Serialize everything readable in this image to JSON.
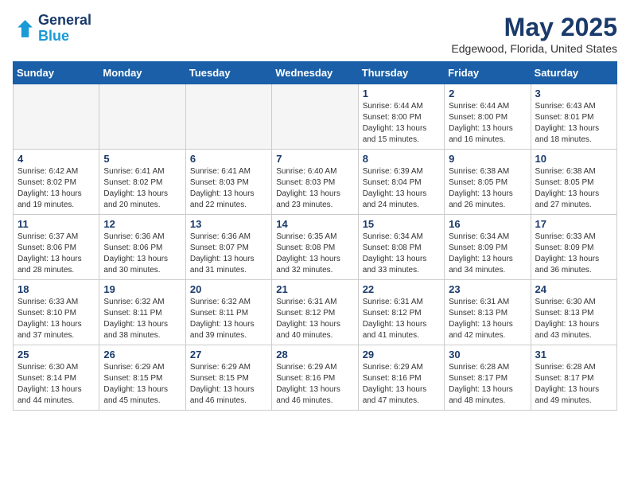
{
  "logo": {
    "line1": "General",
    "line2": "Blue"
  },
  "title": "May 2025",
  "subtitle": "Edgewood, Florida, United States",
  "days_of_week": [
    "Sunday",
    "Monday",
    "Tuesday",
    "Wednesday",
    "Thursday",
    "Friday",
    "Saturday"
  ],
  "weeks": [
    [
      {
        "num": "",
        "info": ""
      },
      {
        "num": "",
        "info": ""
      },
      {
        "num": "",
        "info": ""
      },
      {
        "num": "",
        "info": ""
      },
      {
        "num": "1",
        "info": "Sunrise: 6:44 AM\nSunset: 8:00 PM\nDaylight: 13 hours\nand 15 minutes."
      },
      {
        "num": "2",
        "info": "Sunrise: 6:44 AM\nSunset: 8:00 PM\nDaylight: 13 hours\nand 16 minutes."
      },
      {
        "num": "3",
        "info": "Sunrise: 6:43 AM\nSunset: 8:01 PM\nDaylight: 13 hours\nand 18 minutes."
      }
    ],
    [
      {
        "num": "4",
        "info": "Sunrise: 6:42 AM\nSunset: 8:02 PM\nDaylight: 13 hours\nand 19 minutes."
      },
      {
        "num": "5",
        "info": "Sunrise: 6:41 AM\nSunset: 8:02 PM\nDaylight: 13 hours\nand 20 minutes."
      },
      {
        "num": "6",
        "info": "Sunrise: 6:41 AM\nSunset: 8:03 PM\nDaylight: 13 hours\nand 22 minutes."
      },
      {
        "num": "7",
        "info": "Sunrise: 6:40 AM\nSunset: 8:03 PM\nDaylight: 13 hours\nand 23 minutes."
      },
      {
        "num": "8",
        "info": "Sunrise: 6:39 AM\nSunset: 8:04 PM\nDaylight: 13 hours\nand 24 minutes."
      },
      {
        "num": "9",
        "info": "Sunrise: 6:38 AM\nSunset: 8:05 PM\nDaylight: 13 hours\nand 26 minutes."
      },
      {
        "num": "10",
        "info": "Sunrise: 6:38 AM\nSunset: 8:05 PM\nDaylight: 13 hours\nand 27 minutes."
      }
    ],
    [
      {
        "num": "11",
        "info": "Sunrise: 6:37 AM\nSunset: 8:06 PM\nDaylight: 13 hours\nand 28 minutes."
      },
      {
        "num": "12",
        "info": "Sunrise: 6:36 AM\nSunset: 8:06 PM\nDaylight: 13 hours\nand 30 minutes."
      },
      {
        "num": "13",
        "info": "Sunrise: 6:36 AM\nSunset: 8:07 PM\nDaylight: 13 hours\nand 31 minutes."
      },
      {
        "num": "14",
        "info": "Sunrise: 6:35 AM\nSunset: 8:08 PM\nDaylight: 13 hours\nand 32 minutes."
      },
      {
        "num": "15",
        "info": "Sunrise: 6:34 AM\nSunset: 8:08 PM\nDaylight: 13 hours\nand 33 minutes."
      },
      {
        "num": "16",
        "info": "Sunrise: 6:34 AM\nSunset: 8:09 PM\nDaylight: 13 hours\nand 34 minutes."
      },
      {
        "num": "17",
        "info": "Sunrise: 6:33 AM\nSunset: 8:09 PM\nDaylight: 13 hours\nand 36 minutes."
      }
    ],
    [
      {
        "num": "18",
        "info": "Sunrise: 6:33 AM\nSunset: 8:10 PM\nDaylight: 13 hours\nand 37 minutes."
      },
      {
        "num": "19",
        "info": "Sunrise: 6:32 AM\nSunset: 8:11 PM\nDaylight: 13 hours\nand 38 minutes."
      },
      {
        "num": "20",
        "info": "Sunrise: 6:32 AM\nSunset: 8:11 PM\nDaylight: 13 hours\nand 39 minutes."
      },
      {
        "num": "21",
        "info": "Sunrise: 6:31 AM\nSunset: 8:12 PM\nDaylight: 13 hours\nand 40 minutes."
      },
      {
        "num": "22",
        "info": "Sunrise: 6:31 AM\nSunset: 8:12 PM\nDaylight: 13 hours\nand 41 minutes."
      },
      {
        "num": "23",
        "info": "Sunrise: 6:31 AM\nSunset: 8:13 PM\nDaylight: 13 hours\nand 42 minutes."
      },
      {
        "num": "24",
        "info": "Sunrise: 6:30 AM\nSunset: 8:13 PM\nDaylight: 13 hours\nand 43 minutes."
      }
    ],
    [
      {
        "num": "25",
        "info": "Sunrise: 6:30 AM\nSunset: 8:14 PM\nDaylight: 13 hours\nand 44 minutes."
      },
      {
        "num": "26",
        "info": "Sunrise: 6:29 AM\nSunset: 8:15 PM\nDaylight: 13 hours\nand 45 minutes."
      },
      {
        "num": "27",
        "info": "Sunrise: 6:29 AM\nSunset: 8:15 PM\nDaylight: 13 hours\nand 46 minutes."
      },
      {
        "num": "28",
        "info": "Sunrise: 6:29 AM\nSunset: 8:16 PM\nDaylight: 13 hours\nand 46 minutes."
      },
      {
        "num": "29",
        "info": "Sunrise: 6:29 AM\nSunset: 8:16 PM\nDaylight: 13 hours\nand 47 minutes."
      },
      {
        "num": "30",
        "info": "Sunrise: 6:28 AM\nSunset: 8:17 PM\nDaylight: 13 hours\nand 48 minutes."
      },
      {
        "num": "31",
        "info": "Sunrise: 6:28 AM\nSunset: 8:17 PM\nDaylight: 13 hours\nand 49 minutes."
      }
    ]
  ]
}
